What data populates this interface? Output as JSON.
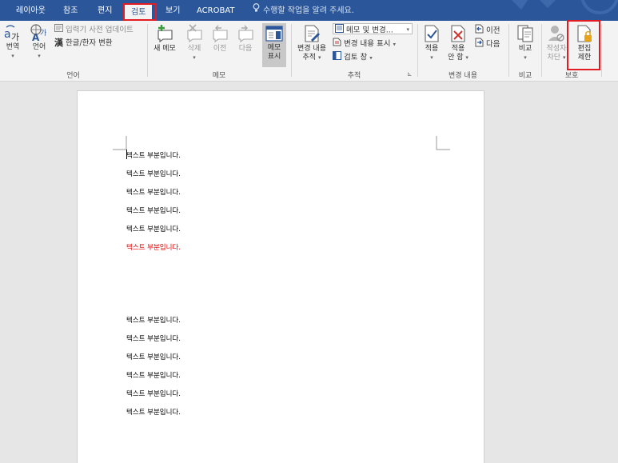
{
  "tabs": [
    {
      "label": "레이아웃"
    },
    {
      "label": "참조"
    },
    {
      "label": "편지"
    },
    {
      "label": "검토"
    },
    {
      "label": "보기"
    },
    {
      "label": "ACROBAT"
    }
  ],
  "tell_me": "수행할 작업을 알려 주세요.",
  "ribbon": {
    "language": {
      "translate": "번역",
      "language": "언어",
      "ime_dictionary": "입력기 사전 업데이트",
      "hanja_convert": "한글/한자 변환",
      "group_label": "언어"
    },
    "comments": {
      "new_comment": "새 메모",
      "delete": "삭제",
      "previous": "이전",
      "next": "다음",
      "show_comments_1": "메모",
      "show_comments_2": "표시",
      "group_label": "메모"
    },
    "tracking": {
      "track_changes_1": "변경 내용",
      "track_changes_2": "추적",
      "show_markup_combo": "메모 및 변경...",
      "show_markup": "변경 내용 표시",
      "reviewing_pane": "검토 창",
      "group_label": "추적"
    },
    "changes": {
      "accept_1": "적용",
      "reject_1": "적용",
      "reject_2": "안 함",
      "previous": "이전",
      "next": "다음",
      "group_label": "변경 내용"
    },
    "compare": {
      "compare": "비교",
      "group_label": "비교"
    },
    "protect": {
      "block_authors_1": "작성자",
      "block_authors_2": "차단",
      "restrict_editing_1": "편집",
      "restrict_editing_2": "제한",
      "group_label": "보호"
    }
  },
  "document": {
    "lines_top": [
      "텍스트 부분입니다.",
      "텍스트 부분입니다.",
      "텍스트 부분입니다.",
      "텍스트 부분입니다.",
      "텍스트 부분입니다.",
      "텍스트 부분입니다."
    ],
    "lines_bottom": [
      "텍스트 부분입니다.",
      "텍스트 부분입니다.",
      "텍스트 부분입니다.",
      "텍스트 부분입니다.",
      "텍스트 부분입니다.",
      "텍스트 부분입니다."
    ]
  },
  "colors": {
    "ribbon_blue": "#2b579a",
    "highlight_red": "#e31c23",
    "red_text": "#e60000"
  }
}
